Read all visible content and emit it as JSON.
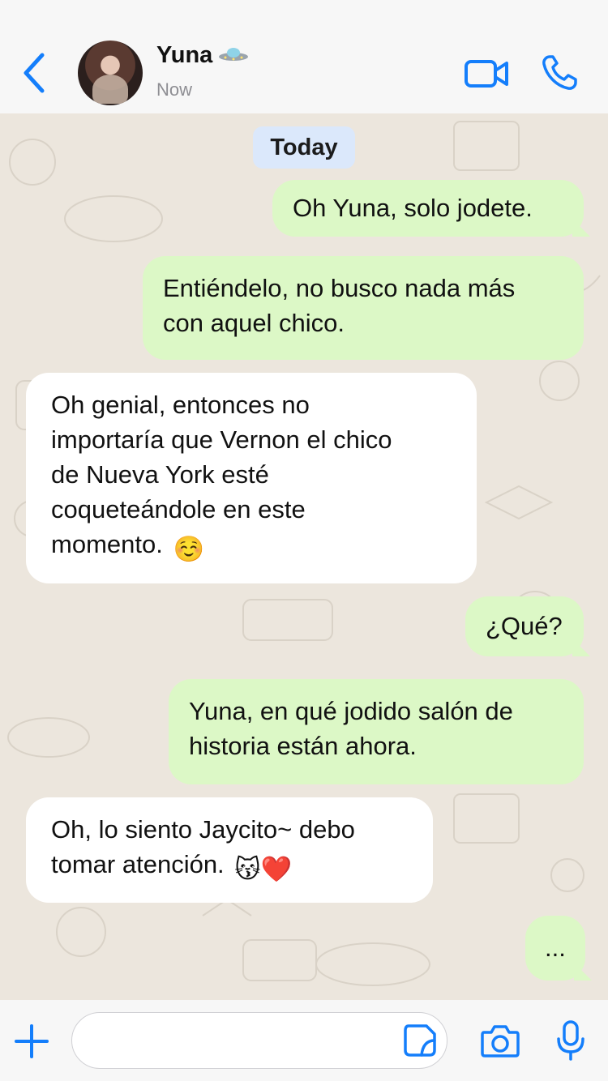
{
  "header": {
    "contact_name": "Yuna",
    "contact_status": "Now",
    "name_emoji": "ufo-emoji"
  },
  "chat": {
    "date_label": "Today",
    "messages": [
      {
        "direction": "outgoing",
        "text": "Oh Yuna, solo jodete."
      },
      {
        "direction": "outgoing",
        "lines": [
          "Entiéndelo, no busco nada más",
          "con aquel chico."
        ]
      },
      {
        "direction": "incoming",
        "lines": [
          "Oh genial, entonces no",
          "importaría que Vernon el chico",
          "de Nueva York esté",
          "coqueteándole en este",
          "momento."
        ],
        "emoji": "☺️"
      },
      {
        "direction": "outgoing",
        "text": "¿Qué?"
      },
      {
        "direction": "outgoing",
        "lines": [
          "Yuna, en qué jodido salón de",
          "historia están ahora."
        ]
      },
      {
        "direction": "incoming",
        "lines": [
          "Oh, lo siento Jaycito~ debo",
          "tomar atención."
        ],
        "emoji": "😽❤️"
      },
      {
        "direction": "outgoing",
        "text": "..."
      }
    ]
  },
  "input": {
    "value": "",
    "placeholder": ""
  },
  "colors": {
    "accent": "#147efb",
    "outgoing_bubble": "#dcf8c6",
    "incoming_bubble": "#ffffff",
    "date_pill": "#dbe8fb",
    "header_bg": "#f7f7f7"
  },
  "icons": [
    "back-chevron-icon",
    "video-camera-icon",
    "phone-icon",
    "plus-icon",
    "sticker-icon",
    "camera-icon",
    "microphone-icon"
  ]
}
